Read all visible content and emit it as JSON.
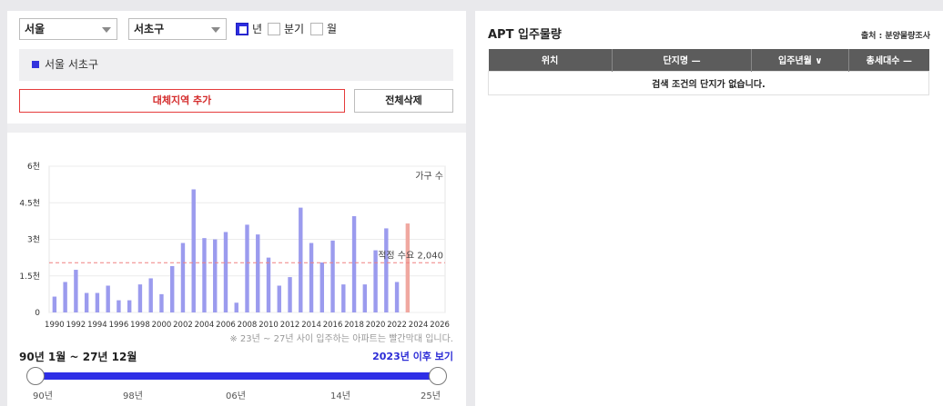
{
  "filters": {
    "city": "서울",
    "district": "서초구",
    "periods": [
      {
        "label": "년",
        "checked": true
      },
      {
        "label": "분기",
        "checked": false
      },
      {
        "label": "월",
        "checked": false
      }
    ]
  },
  "region": {
    "label": "서울 서초구",
    "color": "#3333dd"
  },
  "buttons": {
    "add_region": "대체지역 추가",
    "delete_all": "전체삭제"
  },
  "chart_data": {
    "type": "bar",
    "unit_label": "가구 수",
    "y_ticks": [
      "0",
      "1.5천",
      "3천",
      "4.5천",
      "6천"
    ],
    "ylim": [
      0,
      6000
    ],
    "x_tick_labels": [
      "1990",
      "1992",
      "1994",
      "1996",
      "1998",
      "2000",
      "2002",
      "2004",
      "2006",
      "2008",
      "2010",
      "2012",
      "2014",
      "2016",
      "2018",
      "2020",
      "2022",
      "2024",
      "2026"
    ],
    "xlim": [
      1989.5,
      2026.5
    ],
    "categories": [
      1990,
      1991,
      1992,
      1993,
      1994,
      1995,
      1996,
      1997,
      1998,
      1999,
      2000,
      2001,
      2002,
      2003,
      2004,
      2005,
      2006,
      2007,
      2008,
      2009,
      2010,
      2011,
      2012,
      2013,
      2014,
      2015,
      2016,
      2017,
      2018,
      2019,
      2020,
      2021,
      2022,
      2023
    ],
    "values": [
      650,
      1250,
      1750,
      800,
      800,
      1100,
      500,
      500,
      1150,
      1400,
      750,
      1900,
      2850,
      5050,
      3050,
      3000,
      3300,
      400,
      3600,
      3200,
      2250,
      1100,
      1450,
      4300,
      2850,
      2050,
      2950,
      1150,
      3950,
      1150,
      2550,
      3450,
      1250,
      3650
    ],
    "forecast_from": 2023,
    "bar_color": "#9b9bee",
    "forecast_color": "#f0a8a0",
    "reference_line": {
      "label": "적정 수요 2,040",
      "value": 2040,
      "color": "#f08080"
    }
  },
  "note": "※ 23년 ~ 27년 사이 입주하는 아파트는 빨간막대 입니다.",
  "range": {
    "title": "90년 1월 ~ 27년 12월",
    "after_link": "2023년 이후 보기",
    "tick_labels": [
      "90년",
      "98년",
      "06년",
      "14년",
      "25년"
    ]
  },
  "apt": {
    "title": "APT 입주물량",
    "source": "출처 : 분양물량조사",
    "columns": [
      "위치",
      "단지명 —",
      "입주년월",
      "총세대수 —"
    ],
    "empty_message": "검색 조건의 단지가 없습니다."
  }
}
